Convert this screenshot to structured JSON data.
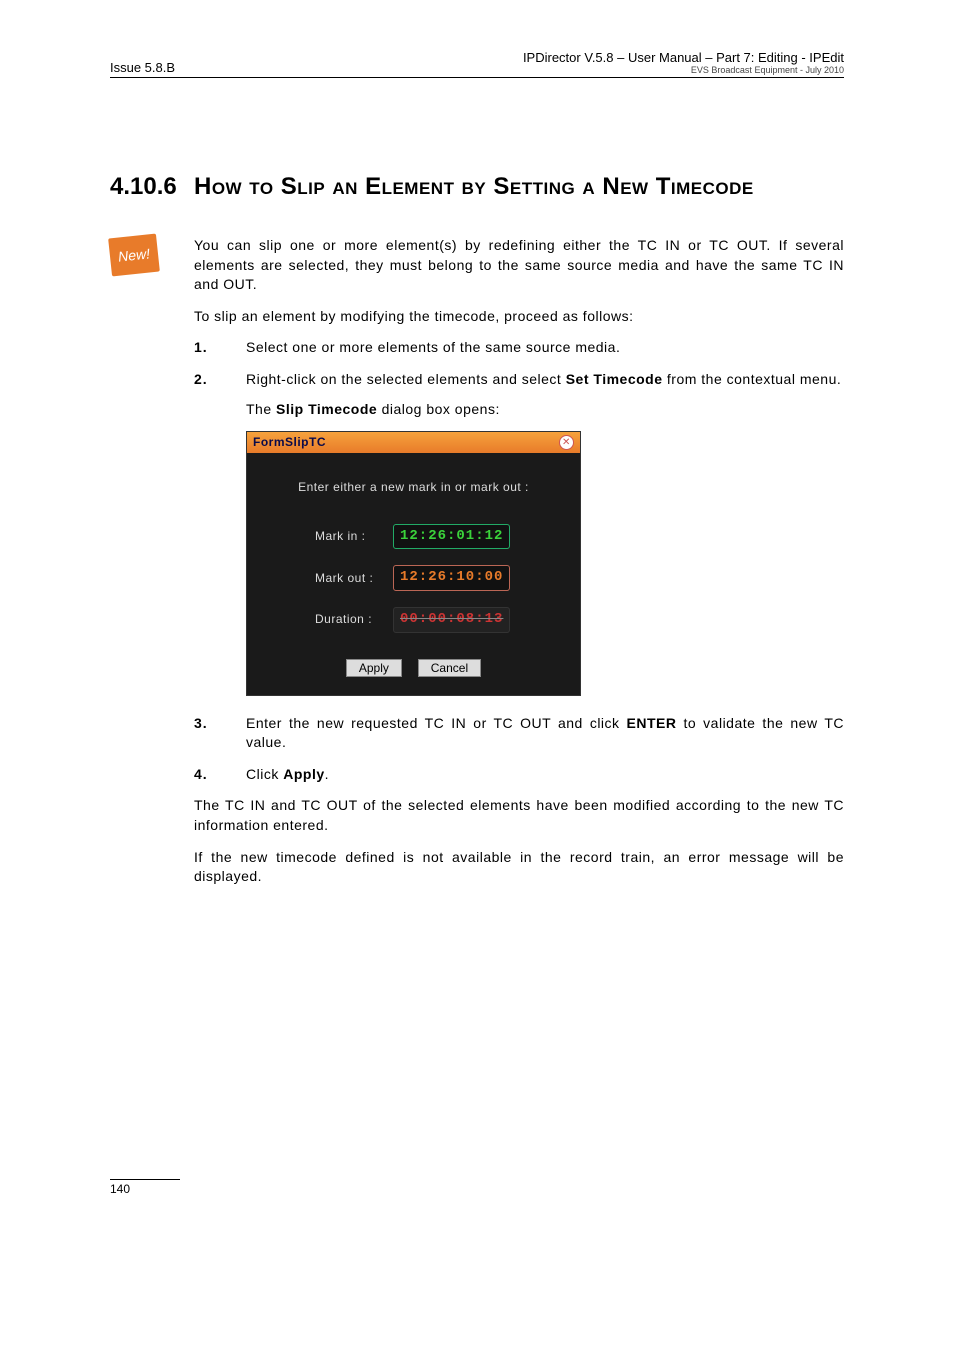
{
  "header": {
    "left": "Issue 5.8.B",
    "right1": "IPDirector V.5.8 – User Manual – Part 7: Editing - IPEdit",
    "right2": "EVS Broadcast Equipment -  July 2010"
  },
  "section": {
    "number": "4.10.6",
    "title": "How to Slip an Element by Setting a New Timecode"
  },
  "badge": "New!",
  "intro1": "You can slip one or more element(s) by redefining either the TC IN or TC OUT. If several elements are selected, they must belong to the same source media and have the same TC IN and OUT.",
  "intro2": "To slip an element by modifying the timecode, proceed as follows:",
  "step1": {
    "num": "1.",
    "txt": "Select one or more elements of the same source media."
  },
  "step2": {
    "num": "2.",
    "pre": "Right-click on the selected elements and select ",
    "bold": "Set Timecode",
    "post": " from the contextual menu.",
    "sub_pre": "The ",
    "sub_bold": "Slip Timecode",
    "sub_post": " dialog box opens:"
  },
  "dialog": {
    "title": "FormSlipTC",
    "msg": "Enter either a new mark in or mark out :",
    "mark_in_lab": "Mark in :",
    "mark_in": "12:26:01:12",
    "mark_out_lab": "Mark out :",
    "mark_out": "12:26:10:00",
    "duration_lab": "Duration :",
    "duration": "00:00:08:13",
    "apply": "Apply",
    "cancel": "Cancel"
  },
  "step3": {
    "num": "3.",
    "pre": "Enter the new requested TC IN or TC OUT and click ",
    "bold": "ENTER",
    "post": " to validate the new TC value."
  },
  "step4": {
    "num": "4.",
    "pre": "Click ",
    "bold": "Apply",
    "post": "."
  },
  "outro1": "The TC IN and TC OUT of the selected elements have been modified according to the new TC information entered.",
  "outro2": "If the new timecode defined is not available in the record train, an error message will be displayed.",
  "footer": {
    "page": "140"
  }
}
